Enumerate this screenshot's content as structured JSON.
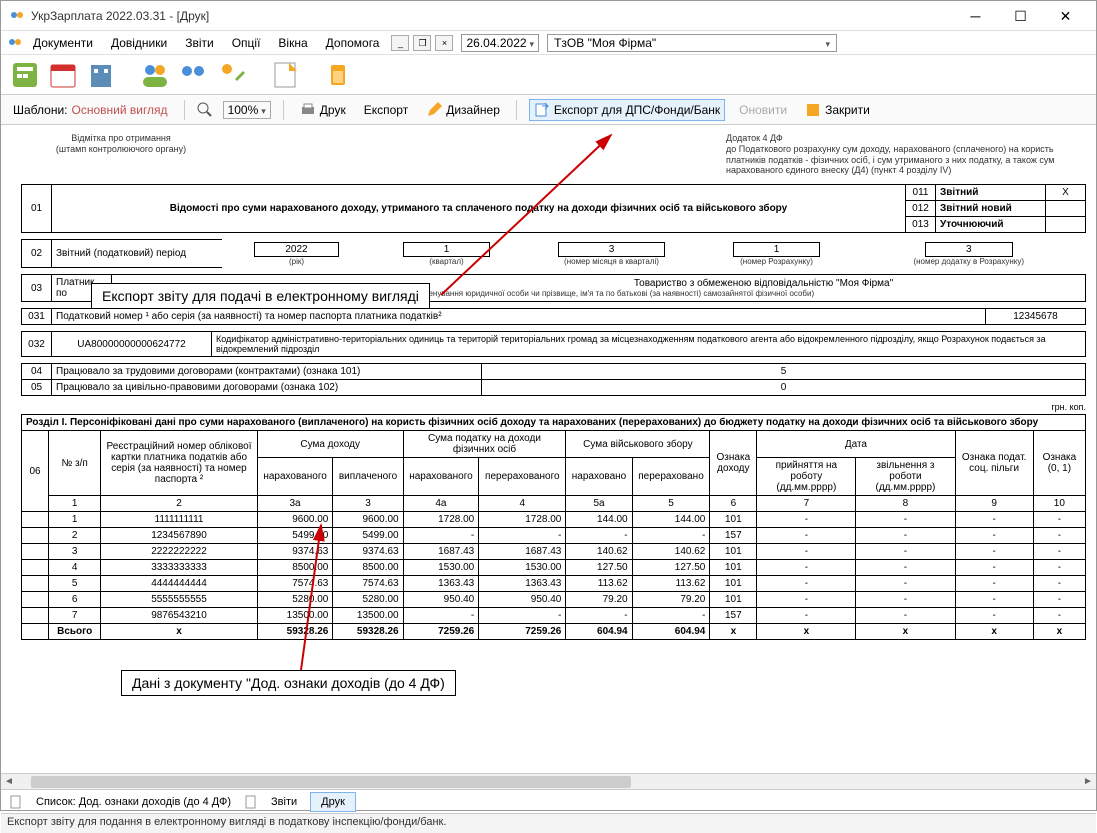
{
  "window": {
    "title": "УкрЗарплата 2022.03.31 - [Друк]"
  },
  "menu": {
    "documents": "Документи",
    "directories": "Довідники",
    "reports": "Звіти",
    "options": "Опції",
    "windows": "Вікна",
    "help": "Допомога",
    "date": "26.04.2022",
    "firm": "ТзОВ \"Моя Фірма\""
  },
  "toolbar": {
    "templates_label": "Шаблони:",
    "template_name": "Основний вигляд",
    "zoom": "100%",
    "print": "Друк",
    "export": "Експорт",
    "designer": "Дизайнер",
    "export_dps": "Експорт для ДПС/Фонди/Банк",
    "refresh": "Оновити",
    "close": "Закрити"
  },
  "report": {
    "stamp_note_l1": "Відмітка про отримання",
    "stamp_note_l2": "(штамп контролюючого органу)",
    "addendum_title": "Додаток 4 ДФ",
    "addendum_desc": "до Податкового розрахунку сум доходу, нарахованого (сплаченого) на користь платників податків - фізичних осіб, і сум утриманого з них податку, а також сум нарахованого єдиного внеску (Д4) (пункт 4 розділу IV)",
    "row01_code": "01",
    "row01_text": "Відомості про суми нарахованого доходу, утриманого та сплаченого податку на доходи фізичних осіб та військового збору",
    "flag_011_code": "011",
    "flag_011_label": "Звітний",
    "flag_011_val": "Х",
    "flag_012_code": "012",
    "flag_012_label": "Звітний новий",
    "flag_012_val": "",
    "flag_013_code": "013",
    "flag_013_label": "Уточнюючий",
    "flag_013_val": "",
    "row02_code": "02",
    "row02_label": "Звітний (податковий) період",
    "period_year": "2022",
    "period_year_note": "(рік)",
    "period_q": "1",
    "period_q_note": "(квартал)",
    "period_m": "3",
    "period_m_note": "(номер місяця в кварталі)",
    "period_calc": "1",
    "period_calc_note": "(номер Розрахунку)",
    "period_app": "3",
    "period_app_note": "(номер додатку в Розрахунку)",
    "row03_code": "03",
    "row03_label": "Платник по",
    "row03_firm": "Товариство з обмеженою відповідальністю \"Моя Фірма\"",
    "row03_note": "(повне найменування юридичної особи чи прізвище, ім'я та по батькові (за наявності) самозайнятої фізичної особи)",
    "row031_code": "031",
    "row031_label": "Податковий номер ¹ або серія (за наявності) та номер паспорта платника податків²",
    "row031_val": "12345678",
    "row032_code": "032",
    "row032_val": "UA80000000000624772",
    "row032_desc": "Кодифікатор адміністративно-територіальних одиниць та територій територіальних громад за місцезнаходженням податкового агента або відокремленного підрозділу, якщо Розрахунок подається за відокремлений підрозділ",
    "row04_code": "04",
    "row04_label": "Працювало за трудовими договорами (контрактами) (ознака 101)",
    "row04_val": "5",
    "row05_code": "05",
    "row05_label": "Працювало за цивільно-правовими договорами (ознака 102)",
    "row05_val": "0",
    "grn_kop": "грн. коп.",
    "section1_title": "Розділ I. Персоніфіковані дані про суми нарахованого (виплаченого) на користь фізичних осіб доходу та нарахованих (перерахованих) до бюджету податку на доходи фізичних осіб та військового збору",
    "row06_code": "06",
    "headers": {
      "nzp": "№ з/п",
      "reg": "Реєстраційний номер облікової картки платника податків або серія (за наявності) та номер паспорта ²",
      "income": "Сума доходу",
      "income_accrued": "нарахованого",
      "income_paid": "виплаченого",
      "tax": "Сума податку на доходи фізичних осіб",
      "tax_accrued": "нарахованого",
      "tax_transferred": "перерахованого",
      "mil": "Сума військового збору",
      "mil_accrued": "нараховано",
      "mil_transferred": "перераховано",
      "income_sign": "Ознака доходу",
      "date": "Дата",
      "date_hire": "прийняття на роботу (дд.мм.рррр)",
      "date_fire": "звільнення з роботи (дд.мм.рррр)",
      "benefit_sign": "Ознака подат. соц. пільги",
      "sign01": "Ознака (0, 1)"
    },
    "colnums": [
      "1",
      "2",
      "3а",
      "3",
      "4а",
      "4",
      "5а",
      "5",
      "6",
      "7",
      "8",
      "9",
      "10"
    ],
    "rows": [
      {
        "n": "1",
        "id": "1111111111",
        "i_a": "9600.00",
        "i_p": "9600.00",
        "t_a": "1728.00",
        "t_p": "1728.00",
        "m_a": "144.00",
        "m_p": "144.00",
        "sign": "101",
        "h": "-",
        "f": "-",
        "b": "-",
        "s": "-"
      },
      {
        "n": "2",
        "id": "1234567890",
        "i_a": "5499.00",
        "i_p": "5499.00",
        "t_a": "-",
        "t_p": "-",
        "m_a": "-",
        "m_p": "-",
        "sign": "157",
        "h": "-",
        "f": "-",
        "b": "-",
        "s": "-"
      },
      {
        "n": "3",
        "id": "2222222222",
        "i_a": "9374.63",
        "i_p": "9374.63",
        "t_a": "1687.43",
        "t_p": "1687.43",
        "m_a": "140.62",
        "m_p": "140.62",
        "sign": "101",
        "h": "-",
        "f": "-",
        "b": "-",
        "s": "-"
      },
      {
        "n": "4",
        "id": "3333333333",
        "i_a": "8500.00",
        "i_p": "8500.00",
        "t_a": "1530.00",
        "t_p": "1530.00",
        "m_a": "127.50",
        "m_p": "127.50",
        "sign": "101",
        "h": "-",
        "f": "-",
        "b": "-",
        "s": "-"
      },
      {
        "n": "5",
        "id": "4444444444",
        "i_a": "7574.63",
        "i_p": "7574.63",
        "t_a": "1363.43",
        "t_p": "1363.43",
        "m_a": "113.62",
        "m_p": "113.62",
        "sign": "101",
        "h": "-",
        "f": "-",
        "b": "-",
        "s": "-"
      },
      {
        "n": "6",
        "id": "5555555555",
        "i_a": "5280.00",
        "i_p": "5280.00",
        "t_a": "950.40",
        "t_p": "950.40",
        "m_a": "79.20",
        "m_p": "79.20",
        "sign": "101",
        "h": "-",
        "f": "-",
        "b": "-",
        "s": "-"
      },
      {
        "n": "7",
        "id": "9876543210",
        "i_a": "13500.00",
        "i_p": "13500.00",
        "t_a": "-",
        "t_p": "-",
        "m_a": "-",
        "m_p": "-",
        "sign": "157",
        "h": "-",
        "f": "-",
        "b": "-",
        "s": "-"
      }
    ],
    "total_label": "Всього",
    "total": {
      "id": "х",
      "i_a": "59328.26",
      "i_p": "59328.26",
      "t_a": "7259.26",
      "t_p": "7259.26",
      "m_a": "604.94",
      "m_p": "604.94",
      "sign": "х",
      "h": "х",
      "f": "х",
      "b": "х",
      "s": "х"
    }
  },
  "callouts": {
    "export_note": "Експорт звіту для подачі в електронному вигляді",
    "data_note": "Дані з документу \"Дод. ознаки доходів (до 4 ДФ)"
  },
  "tabs": {
    "list": "Список: Дод. ознаки доходів (до 4 ДФ)",
    "reports": "Звіти",
    "print": "Друк"
  },
  "statusbar": "Експорт звіту для подання в електронному вигляді в податкову інспекцію/фонди/банк."
}
